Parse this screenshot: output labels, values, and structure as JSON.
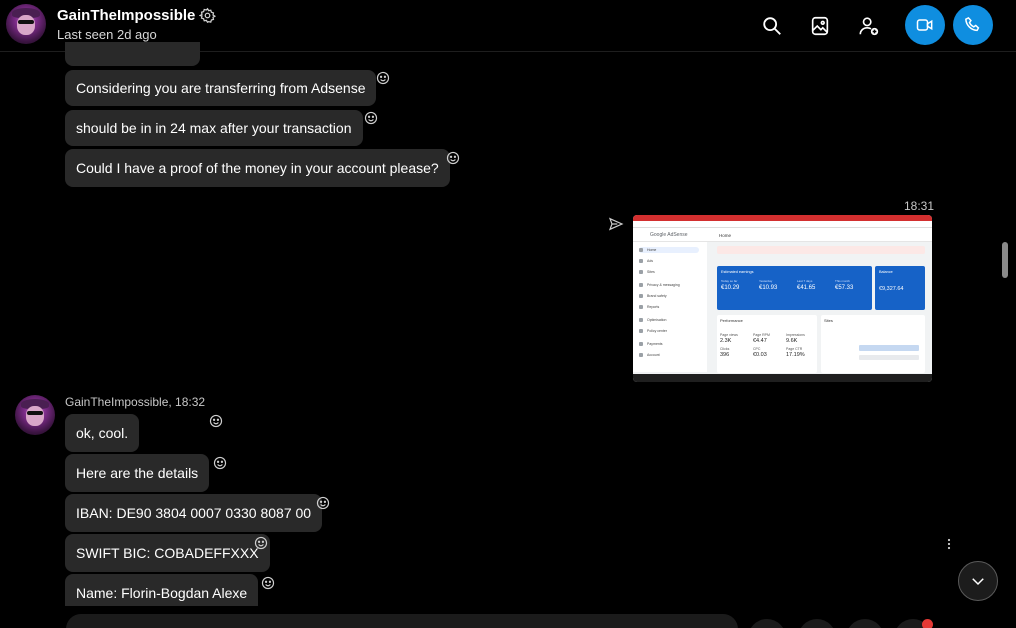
{
  "header": {
    "contact_name": "GainTheImpossible",
    "status": "Last seen 2d ago",
    "icons": [
      "search-icon",
      "gallery-icon",
      "add-person-icon",
      "video-call-icon",
      "audio-call-icon"
    ],
    "accent_color": "#0f8ee0"
  },
  "messages": {
    "earlier": [
      {
        "text": "Considering you are transferring from Adsense"
      },
      {
        "text": "should be in in 24 max after your transaction"
      },
      {
        "text": "Could I have a proof of the money in your account please?"
      }
    ],
    "sent_image": {
      "time": "18:31",
      "screenshot": {
        "brand": "Google AdSense",
        "page": "Home",
        "sidebar": [
          "Home",
          "Ads",
          "Sites",
          "Privacy & messaging",
          "Brand safety",
          "Reports",
          "Optimisation",
          "Policy center",
          "Payments",
          "Account"
        ],
        "estimated_earnings_title": "Estimated earnings",
        "stats": [
          {
            "label": "Today so far",
            "value": "€10.29"
          },
          {
            "label": "Yesterday",
            "value": "€10.93"
          },
          {
            "label": "Last 7 days",
            "value": "€41.65"
          },
          {
            "label": "This month",
            "value": "€57.33"
          }
        ],
        "balance_title": "Balance",
        "balance_value": "€9,327.64",
        "performance_title": "Performance",
        "performance": [
          {
            "label": "Page views",
            "value": "2.3K"
          },
          {
            "label": "Page RPM",
            "value": "€4.47"
          },
          {
            "label": "Impressions",
            "value": "9.6K"
          },
          {
            "label": "Clicks",
            "value": "396"
          },
          {
            "label": "CPC",
            "value": "€0.03"
          },
          {
            "label": "Page CTR",
            "value": "17.19%"
          }
        ],
        "sites_title": "Sites"
      }
    },
    "later": {
      "sender": "GainTheImpossible, 18:32",
      "items": [
        {
          "text": "ok, cool."
        },
        {
          "text": "Here are the details"
        },
        {
          "text": "IBAN: DE90 3804 0007 0330 8087 00"
        },
        {
          "text": "SWIFT BIC: COBADEFFXXX"
        },
        {
          "text": "Name: Florin-Bogdan Alexe"
        }
      ]
    }
  }
}
